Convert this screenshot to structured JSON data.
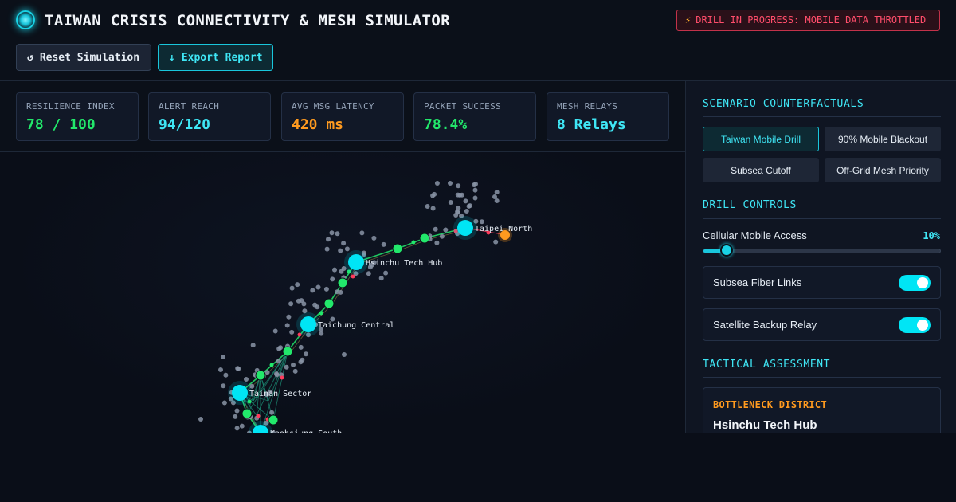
{
  "header": {
    "title": "TAIWAN CRISIS CONNECTIVITY & MESH SIMULATOR",
    "logo_icon": "radar-icon",
    "alert": {
      "icon": "bolt-icon",
      "glyph": "⚡",
      "text": "DRILL IN PROGRESS: MOBILE DATA THROTTLED"
    },
    "buttons": {
      "reset": {
        "icon": "↺",
        "label": "Reset Simulation"
      },
      "export": {
        "icon": "↓",
        "label": "Export Report"
      }
    }
  },
  "metrics": [
    {
      "label": "RESILIENCE INDEX",
      "value": "78 / 100",
      "color": "#22e86b"
    },
    {
      "label": "ALERT REACH",
      "value": "94/120",
      "color": "#3fe6f5"
    },
    {
      "label": "AVG MSG LATENCY",
      "value": "420 ms",
      "color": "#ff9a1f"
    },
    {
      "label": "PACKET SUCCESS",
      "value": "78.4%",
      "color": "#22e86b"
    },
    {
      "label": "MESH RELAYS",
      "value": "8 Relays",
      "color": "#3fe6f5"
    }
  ],
  "map": {
    "hubs": [
      {
        "name": "Taipei North"
      },
      {
        "name": "Hsinchu Tech Hub"
      },
      {
        "name": "Taichung Central"
      },
      {
        "name": "Tainan Sector"
      },
      {
        "name": "Kaohsiung South"
      }
    ],
    "colors": {
      "hub": "#00e5f5",
      "relay": "#22e86b",
      "device": "#8a94a6",
      "failed": "#ff3b5c",
      "origin": "#ff9a1f",
      "link": "#22e86b"
    }
  },
  "sidebar": {
    "scenarios": {
      "title": "SCENARIO COUNTERFACTUALS",
      "items": [
        {
          "label": "Taiwan Mobile Drill",
          "active": true
        },
        {
          "label": "90% Mobile Blackout",
          "active": false
        },
        {
          "label": "Subsea Cutoff",
          "active": false
        },
        {
          "label": "Off-Grid Mesh Priority",
          "active": false
        }
      ]
    },
    "controls": {
      "title": "DRILL CONTROLS",
      "slider": {
        "label": "Cellular Mobile Access",
        "value": 10,
        "display": "10%"
      },
      "toggles": [
        {
          "label": "Subsea Fiber Links",
          "on": true
        },
        {
          "label": "Satellite Backup Relay",
          "on": true
        }
      ]
    },
    "assessment": {
      "title": "TACTICAL ASSESSMENT",
      "kicker": "BOTTLENECK DISTRICT",
      "district": "Hsinchu Tech Hub"
    }
  }
}
